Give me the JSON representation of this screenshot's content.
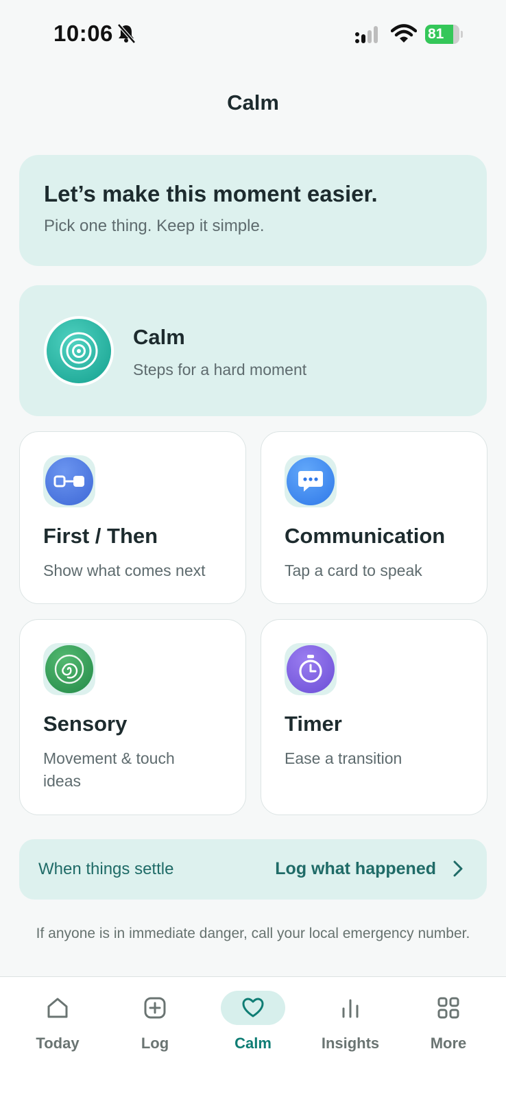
{
  "status_bar": {
    "time": "10:06",
    "battery": "81",
    "battery_level": 0.81
  },
  "page": {
    "title": "Calm"
  },
  "hero": {
    "title": "Let’s make this moment easier.",
    "subtitle": "Pick one thing. Keep it simple."
  },
  "calm_card": {
    "title": "Calm",
    "subtitle": "Steps for a hard moment",
    "icon": "target-spiral-icon"
  },
  "tools": [
    {
      "title": "First / Then",
      "subtitle": "Show what comes next",
      "icon": "first-then-icon",
      "color": "#4A78E0"
    },
    {
      "title": "Communication",
      "subtitle": "Tap a card to speak",
      "icon": "chat-bubble-icon",
      "color": "#3D86F0"
    },
    {
      "title": "Sensory",
      "subtitle": "Movement & touch ideas",
      "icon": "spiral-icon",
      "color": "#2E9A55"
    },
    {
      "title": "Timer",
      "subtitle": "Ease a transition",
      "icon": "stopwatch-icon",
      "color": "#7C5CE0"
    }
  ],
  "log_banner": {
    "left_text": "When things settle",
    "action_label": "Log what happened"
  },
  "disclaimer": "If anyone is in immediate danger, call your local emergency number.",
  "tab_bar": {
    "tabs": [
      {
        "label": "Today",
        "icon": "home-icon"
      },
      {
        "label": "Log",
        "icon": "plus-square-icon"
      },
      {
        "label": "Calm",
        "icon": "heart-icon",
        "active": true
      },
      {
        "label": "Insights",
        "icon": "bar-chart-icon"
      },
      {
        "label": "More",
        "icon": "grid-icon"
      }
    ]
  },
  "colors": {
    "accent": "#0F7D74",
    "card_tint": "#DDF1EE"
  }
}
